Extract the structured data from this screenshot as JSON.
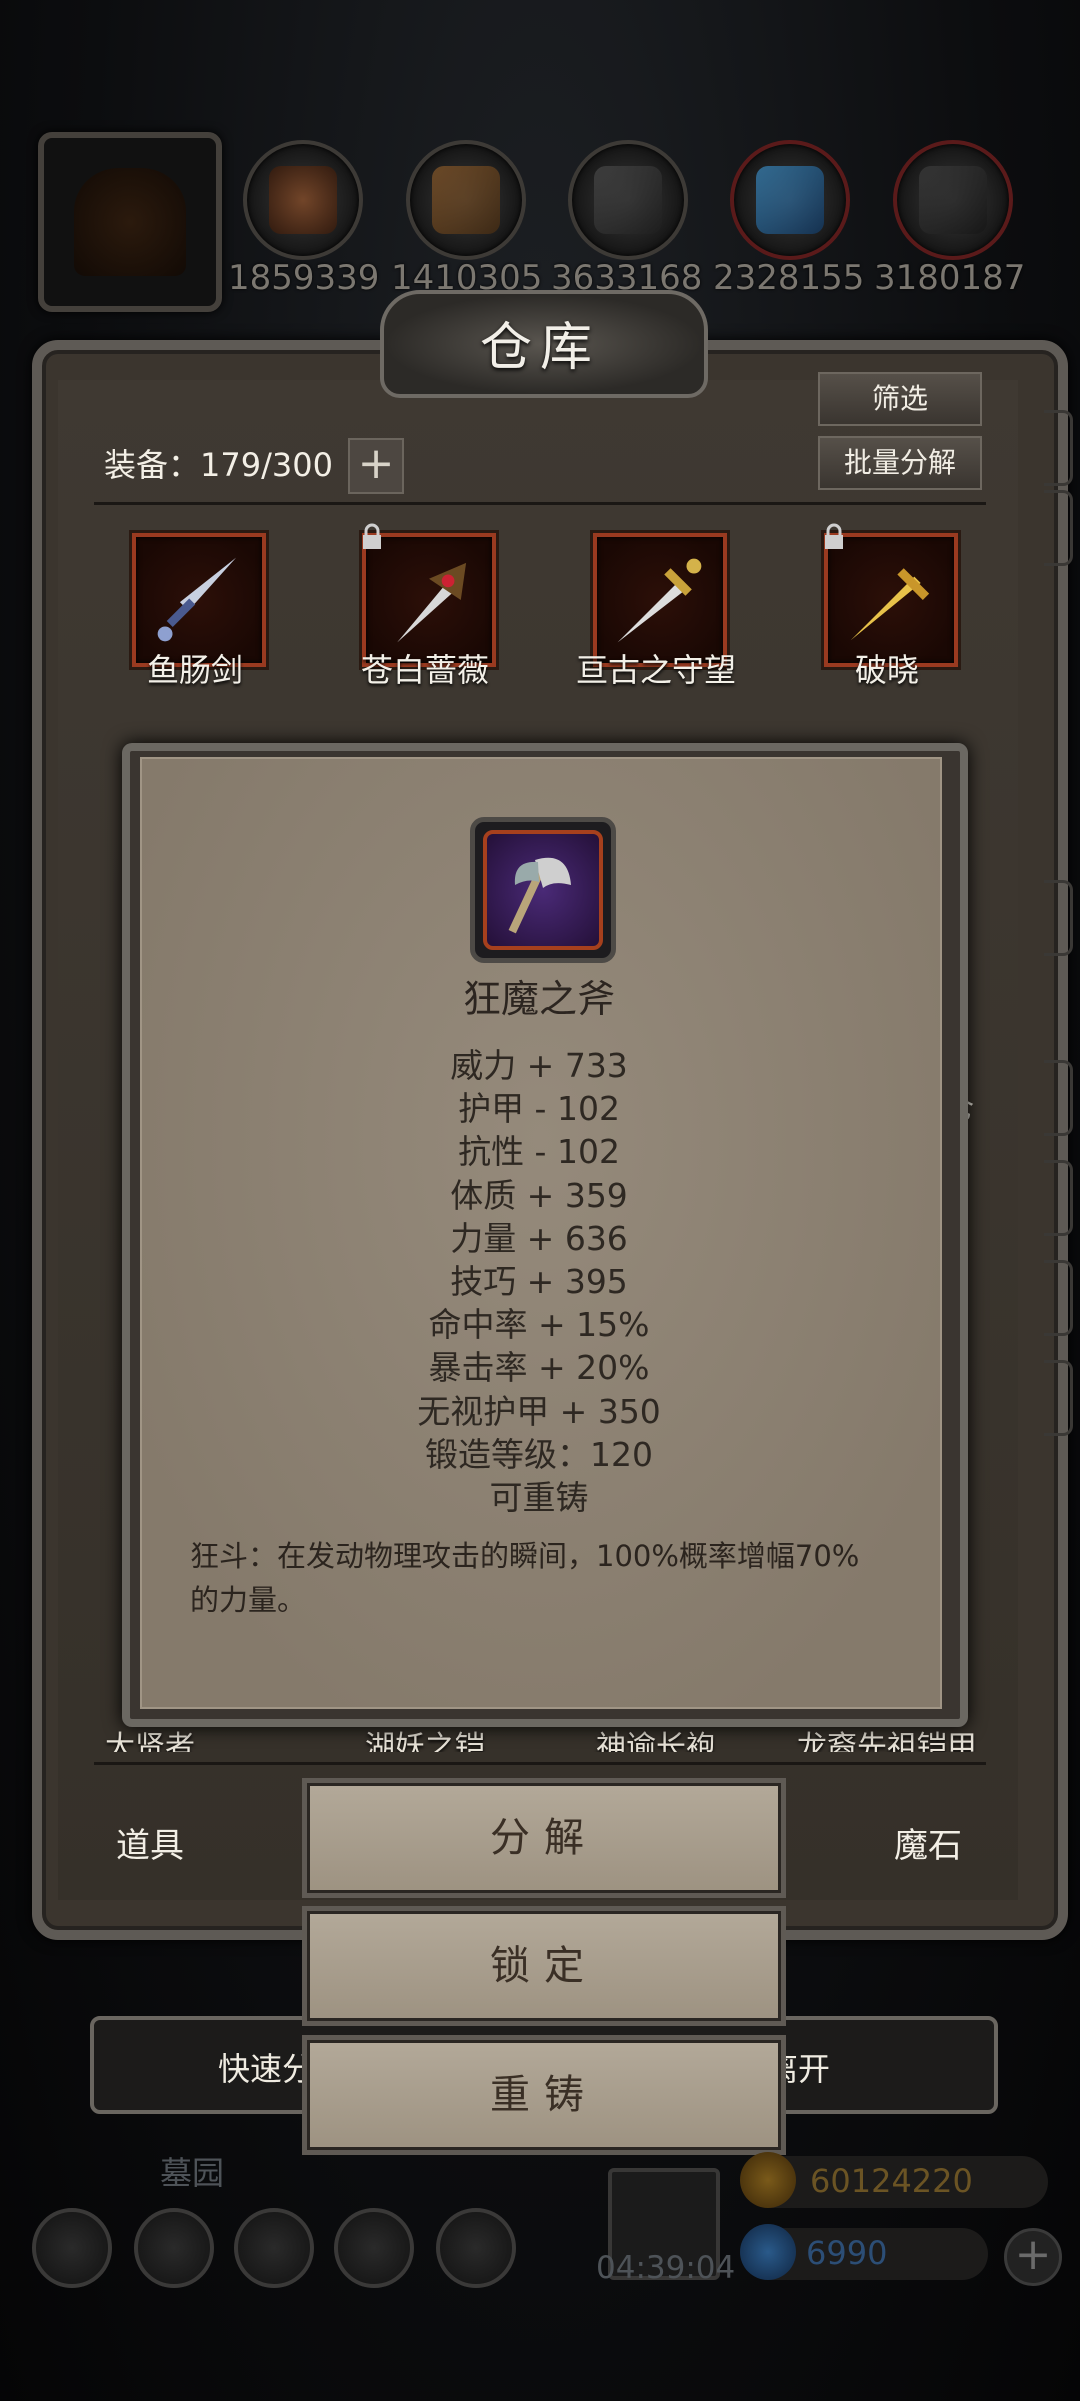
{
  "top_bar": {
    "counts": [
      "1859339",
      "1410305",
      "3633168",
      "2328155",
      "3180187"
    ]
  },
  "warehouse": {
    "title": "仓库",
    "filter_label": "筛选",
    "bulk_decompose_label": "批量分解",
    "equip_label": "装备：179/300",
    "add_label": "+",
    "items": [
      {
        "name": "鱼肠剑",
        "locked": false
      },
      {
        "name": "苍白蔷薇",
        "locked": true
      },
      {
        "name": "亘古之守望",
        "locked": false
      },
      {
        "name": "破晓",
        "locked": true
      }
    ],
    "bottom_items": [
      "大贤者",
      "湖妖之铠",
      "神谕长袍",
      "龙裔先祖铠甲"
    ],
    "tabs": {
      "left": "道具",
      "right": "魔石"
    },
    "quick_left": "快速分",
    "quick_right": "离开",
    "side_text": "仓"
  },
  "popup": {
    "item_name": "狂魔之斧",
    "stats": [
      "威力 + 733",
      "护甲 - 102",
      "抗性 - 102",
      "体质 + 359",
      "力量 + 636",
      "技巧 + 395",
      "命中率 + 15%",
      "暴击率 + 20%",
      "无视护甲 + 350",
      "锻造等级：120",
      "可重铸"
    ],
    "description": "狂斗：在发动物理攻击的瞬间，100%概率增幅70%的力量。",
    "actions": {
      "decompose": "分解",
      "lock": "锁定",
      "recast": "重铸"
    }
  },
  "bottom_bar": {
    "location": "墓园",
    "timer": "04:39:04",
    "gold": "60124220",
    "gems": "6990",
    "add_label": "+"
  },
  "colors": {
    "item_border": "#9a3a20",
    "parchment": "#8a7f70",
    "frame": "#5e5a55"
  }
}
